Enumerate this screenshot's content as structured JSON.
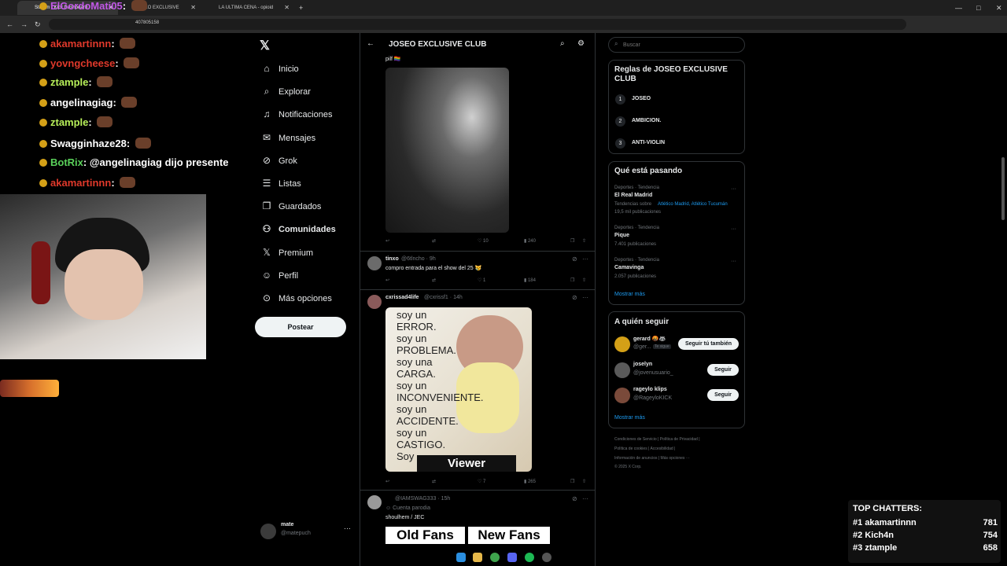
{
  "browser": {
    "tabs": [
      {
        "title": "Stream - Kick Dashboard"
      },
      {
        "title": "JOSEO EXCLUSIVE"
      },
      {
        "title": "LA ULTIMA CENA - opioid"
      }
    ],
    "address_fragment": "407805158"
  },
  "stream_chat": [
    {
      "user": "ElGordoMati05",
      "color": "#c157e6",
      "text": ""
    },
    {
      "user": "akamartinnn",
      "color": "#e0392b",
      "text": ""
    },
    {
      "user": "yovngcheese",
      "color": "#e0392b",
      "text": ""
    },
    {
      "user": "ztample",
      "color": "#b8f05a",
      "text": ""
    },
    {
      "user": "angelinagiag",
      "color": "#ffffff",
      "text": ""
    },
    {
      "user": "ztample",
      "color": "#b8f05a",
      "text": ""
    },
    {
      "user": "Swagginhaze28",
      "color": "#ffffff",
      "text": ""
    },
    {
      "user": "BotRix",
      "color": "#5ad15a",
      "text": "@angelinagiag dijo presente"
    },
    {
      "user": "akamartinnn",
      "color": "#e0392b",
      "text": ""
    }
  ],
  "nav": {
    "items": [
      {
        "label": "Inicio",
        "icon": "home-icon",
        "glyph": "⌂"
      },
      {
        "label": "Explorar",
        "icon": "search-icon",
        "glyph": "⌕"
      },
      {
        "label": "Notificaciones",
        "icon": "bell-icon",
        "glyph": "♫"
      },
      {
        "label": "Mensajes",
        "icon": "mail-icon",
        "glyph": "✉"
      },
      {
        "label": "Grok",
        "icon": "grok-icon",
        "glyph": "⊘"
      },
      {
        "label": "Listas",
        "icon": "list-icon",
        "glyph": "☰"
      },
      {
        "label": "Guardados",
        "icon": "bookmark-icon",
        "glyph": "❐"
      },
      {
        "label": "Comunidades",
        "icon": "communities-icon",
        "glyph": "⚇"
      },
      {
        "label": "Premium",
        "icon": "x-logo-icon",
        "glyph": "𝕏"
      },
      {
        "label": "Perfil",
        "icon": "person-icon",
        "glyph": "☺"
      },
      {
        "label": "Más opciones",
        "icon": "more-circle-icon",
        "glyph": "⊙"
      }
    ],
    "post_label": "Postear",
    "account_name": "mate",
    "account_handle": "@matepuch"
  },
  "community": {
    "title": "JOSEO EXCLUSIVE CLUB"
  },
  "tweets": [
    {
      "text": "pilf 🏳️‍🌈",
      "stats": {
        "reply": "",
        "repost": "",
        "like": "10",
        "views": "240"
      }
    },
    {
      "name": "tinxo",
      "handle": "@6tlncho",
      "time": "9h",
      "text": "compro entrada para el show del 25 😿",
      "stats": {
        "reply": "",
        "repost": "",
        "like": "1",
        "views": "184"
      }
    },
    {
      "name": "cxrissad4life",
      "handle": "@cxrissf1",
      "time": "14h",
      "image_lines": [
        "soy un",
        "ERROR.",
        "soy un",
        "PROBLEMA.",
        "soy una",
        "CARGA.",
        "soy un",
        "INCONVENIENTE.",
        "soy un",
        "ACCIDENTE.",
        "soy un",
        "CASTIGO.",
        "Soy"
      ],
      "image_caption": "Viewer",
      "stats": {
        "reply": "",
        "repost": "",
        "like": "7",
        "views": "265"
      }
    },
    {
      "name": "",
      "handle": "@IAMSWAG333",
      "time": "15h",
      "sub": "Cuenta parodia",
      "text": "shoulhem / JEC",
      "meme_left": "Old Fans",
      "meme_right": "New Fans"
    }
  ],
  "search": {
    "placeholder": "Buscar"
  },
  "rules": {
    "title": "Reglas de JOSEO EXCLUSIVE CLUB",
    "items": [
      {
        "num": "1",
        "text": "JOSEO"
      },
      {
        "num": "2",
        "text": "AMBICION."
      },
      {
        "num": "3",
        "text": "ANTI-VIOLIN"
      }
    ]
  },
  "trends": {
    "title": "Qué está pasando",
    "items": [
      {
        "category": "Deportes · Tendencia",
        "name": "El Real Madrid",
        "extra": "Tendencias sobre",
        "extra_links": "Atlético Madrid, Atlético Tucumán",
        "count": "19,5 mil publicaciones"
      },
      {
        "category": "Deportes · Tendencia",
        "name": "Pique",
        "count": "7.401 publicaciones"
      },
      {
        "category": "Deportes · Tendencia",
        "name": "Camavinga",
        "count": "2.057 publicaciones"
      }
    ],
    "more": "Mostrar más"
  },
  "who_to_follow": {
    "title": "A quién seguir",
    "items": [
      {
        "name": "gerard 🤬🦝",
        "handle": "@ger...",
        "tag": "Te sigue",
        "button": "Seguir tú también"
      },
      {
        "name": "joselyn",
        "handle": "@jovenusuario_",
        "button": "Seguir"
      },
      {
        "name": "rageylo klips",
        "handle": "@RageyloKICK",
        "button": "Seguir"
      }
    ],
    "more": "Mostrar más"
  },
  "footer": {
    "line1": "Condiciones de Servicio  |  Política de Privacidad  |",
    "line2": "Política de cookies  |  Accesibilidad  |",
    "line3": "Información de anuncios  |  Más opciones ···",
    "line4": "© 2025 X Corp."
  },
  "top_chatters": {
    "title": "TOP CHATTERS:",
    "items": [
      {
        "rank": "#1",
        "name": "akamartinnn",
        "count": "781"
      },
      {
        "rank": "#2",
        "name": "Kich4n",
        "count": "754"
      },
      {
        "rank": "#3",
        "name": "ztample",
        "count": "658"
      }
    ]
  },
  "colors": {
    "accent": "#1d9bf0",
    "bg": "#000000",
    "border": "#2f3336"
  }
}
